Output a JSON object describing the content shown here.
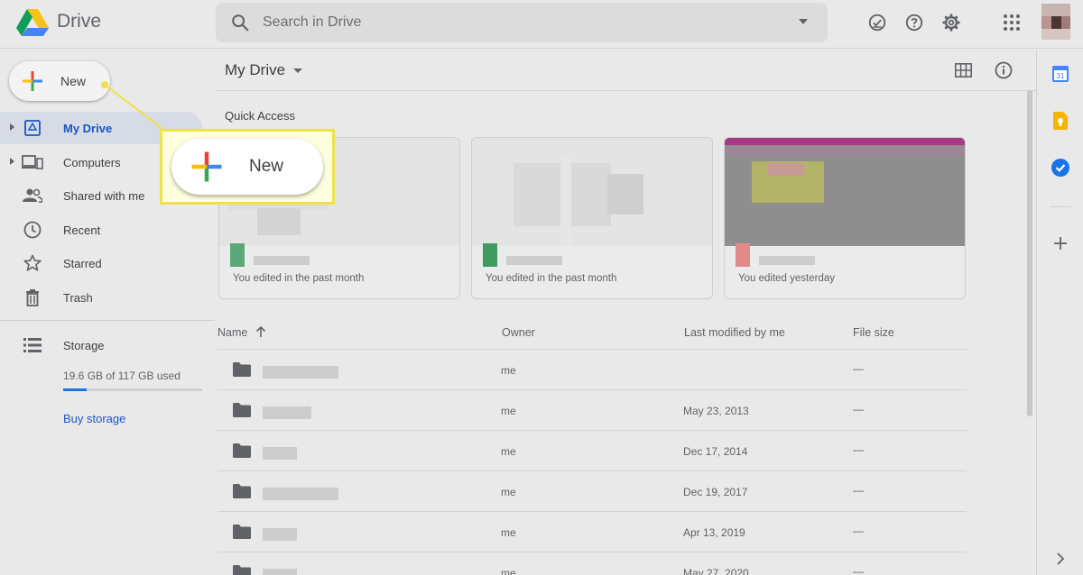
{
  "header": {
    "app_name": "Drive",
    "search_placeholder": "Search in Drive",
    "icons": [
      "drive-logo-icon",
      "search-icon",
      "offline-check-icon",
      "help-icon",
      "settings-icon",
      "apps-grid-icon"
    ]
  },
  "sidebar": {
    "new_label": "New",
    "items": [
      {
        "label": "My Drive",
        "icon": "my-drive-icon",
        "active": true
      },
      {
        "label": "Computers",
        "icon": "computers-icon",
        "active": false
      },
      {
        "label": "Shared with me",
        "icon": "shared-icon",
        "active": false
      },
      {
        "label": "Recent",
        "icon": "clock-icon",
        "active": false
      },
      {
        "label": "Starred",
        "icon": "star-icon",
        "active": false
      },
      {
        "label": "Trash",
        "icon": "trash-icon",
        "active": false
      }
    ],
    "storage": {
      "label": "Storage",
      "usage": "19.6 GB of 117 GB used",
      "used_fraction": 0.1675,
      "buy_label": "Buy storage"
    }
  },
  "main": {
    "title": "My Drive",
    "quick_access_title": "Quick Access",
    "cards": [
      {
        "caption": "You edited in the past month",
        "file_color": "#5aa878"
      },
      {
        "caption": "You edited in the past month",
        "file_color": "#3f9a5e"
      },
      {
        "caption": "You edited yesterday",
        "file_color": "#e08a8a"
      }
    ],
    "columns": {
      "name": "Name",
      "owner": "Owner",
      "modified": "Last modified by me",
      "size": "File size"
    },
    "rows": [
      {
        "owner": "me",
        "modified": "",
        "size": "—"
      },
      {
        "owner": "me",
        "modified": "May 23, 2013",
        "size": "—"
      },
      {
        "owner": "me",
        "modified": "Dec 17, 2014",
        "size": "—"
      },
      {
        "owner": "me",
        "modified": "Dec 19, 2017",
        "size": "—"
      },
      {
        "owner": "me",
        "modified": "Apr 13, 2019",
        "size": "—"
      },
      {
        "owner": "me",
        "modified": "May 27, 2020",
        "size": "—"
      }
    ]
  },
  "callout": {
    "new_label": "New",
    "highlight_color": "#f0e04a"
  },
  "side_panel": {
    "calendar_day": "31",
    "icons": [
      "calendar-icon",
      "keep-icon",
      "tasks-icon",
      "add-addon-icon",
      "expand-panel-icon"
    ]
  }
}
